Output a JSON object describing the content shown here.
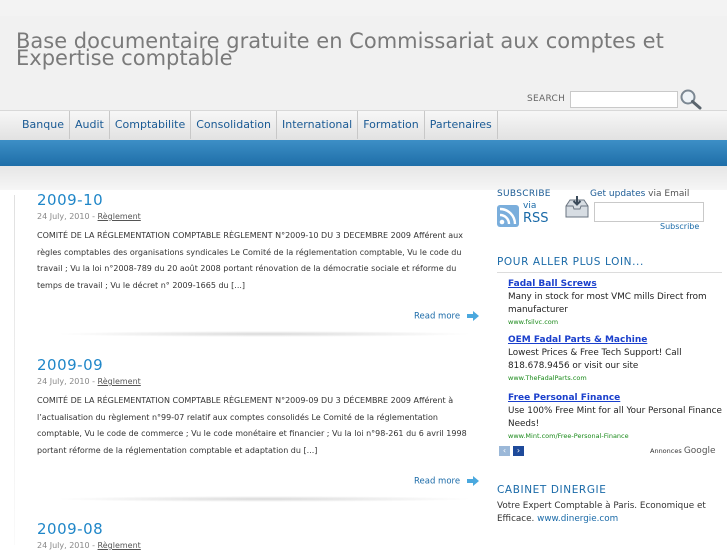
{
  "header": {
    "site_title": "Base documentaire gratuite en Commissariat aux comptes et Expertise comptable",
    "search_label": "SEARCH",
    "search_value": ""
  },
  "nav": {
    "items": [
      "Banque",
      "Audit",
      "Comptabilite",
      "Consolidation",
      "International",
      "Formation",
      "Partenaires"
    ]
  },
  "posts": [
    {
      "title": "2009-10",
      "date": "24 July, 2010",
      "sep": " - ",
      "category": "Règlement",
      "body": "COMITÉ DE LA RÉGLEMENTATION COMPTABLE RÈGLEMENT N°2009-10 DU 3 DECEMBRE 2009 Afférent aux règles comptables des organisations syndicales Le Comité de la réglementation comptable, Vu le code du travail ; Vu la loi n°2008-789 du 20 août 2008 portant rénovation de la démocratie sociale et réforme du temps de travail ; Vu le décret n° 2009-1665 du [...]",
      "read_more": "Read more"
    },
    {
      "title": "2009-09",
      "date": "24 July, 2010",
      "sep": " - ",
      "category": "Règlement",
      "body": "COMITÉ DE LA RÉGLEMENTATION COMPTABLE RÈGLEMENT N°2009-09 DU 3 DÉCEMBRE 2009 Afférent à l’actualisation du règlement n°99-07 relatif aux comptes consolidés Le Comité de la réglementation comptable, Vu le code de commerce ; Vu le code monétaire et financier ; Vu la loi n°98-261 du 6 avril 1998 portant réforme de la réglementation comptable et adaptation du [...]",
      "read_more": "Read more"
    },
    {
      "title": "2009-08",
      "date": "24 July, 2010",
      "sep": " - ",
      "category": "Règlement"
    }
  ],
  "sidebar": {
    "subscribe_label": "SUBSCRIBE",
    "rss_via": "via",
    "rss_label": "RSS",
    "get_updates": "Get updates",
    "via_email": " via Email",
    "email_value": "",
    "subscribe_button": "Subscribe",
    "widget_title": "POUR ALLER PLUS LOIN...",
    "ads": [
      {
        "title": "Fadal Ball Screws",
        "text": "Many in stock for most VMC mills Direct from manufacturer",
        "url": "www.fsilvc.com"
      },
      {
        "title": "OEM Fadal Parts & Machine",
        "text": "Lowest Prices & Free Tech Support! Call 818.678.9456 or visit our site",
        "url": "www.TheFadalParts.com"
      },
      {
        "title": "Free Personal Finance",
        "text": "Use 100% Free Mint for all Your Personal Finance Needs!",
        "url": "www.Mint.com/Free-Personal-Finance"
      }
    ],
    "ads_label": "Annonces",
    "ads_brand": "Google",
    "ad_prev": "‹",
    "ad_next": "›",
    "cabinet_title": "CABINET DINERGIE",
    "cabinet_text": "Votre Expert Comptable à Paris. Economique et Efficace. ",
    "cabinet_link": "www.dinergie.com"
  },
  "colors": {
    "accent": "#1f86c8",
    "blue_bar": "#2a7ab5",
    "link": "#1a6aa8",
    "ad_title": "#1a3fcc",
    "ad_url": "#1a8a1a"
  }
}
